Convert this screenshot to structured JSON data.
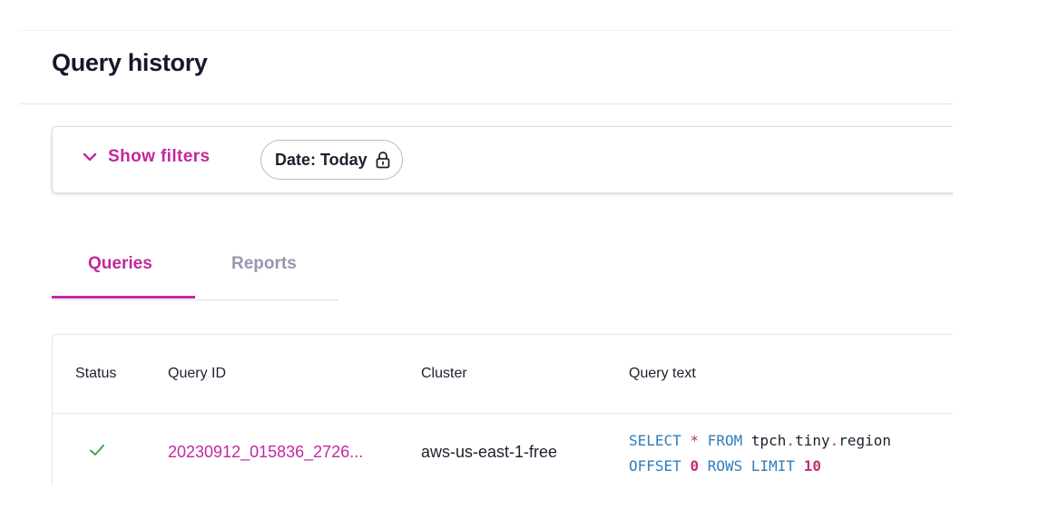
{
  "header": {
    "title": "Query history"
  },
  "filters": {
    "toggle_label": "Show filters",
    "chip_label": "Date: Today",
    "toggle_icon": "chevron-down-icon",
    "chip_icon": "lock-icon"
  },
  "tabs": [
    {
      "label": "Queries",
      "active": true
    },
    {
      "label": "Reports",
      "active": false
    }
  ],
  "table": {
    "columns": [
      "Status",
      "Query ID",
      "Cluster",
      "Query text"
    ],
    "rows": [
      {
        "status_icon": "checkmark-icon",
        "query_id": "20230912_015836_2726...",
        "cluster": "aws-us-east-1-free",
        "query_text": {
          "line1": {
            "kw1": "SELECT",
            "op": "*",
            "kw2": "FROM",
            "table": "tpch",
            "dot1": ".",
            "schema": "tiny",
            "dot2": ".",
            "name": "region"
          },
          "line2": {
            "kw1": "OFFSET",
            "n1": "0",
            "kw2": "ROWS",
            "kw3": "LIMIT",
            "n2": "10"
          }
        }
      }
    ]
  },
  "colors": {
    "accent": "#c2289e",
    "sql_keyword": "#2f7dbd",
    "sql_number": "#c52e7a",
    "success": "#3aa757",
    "inactive_tab": "#9598ae"
  }
}
